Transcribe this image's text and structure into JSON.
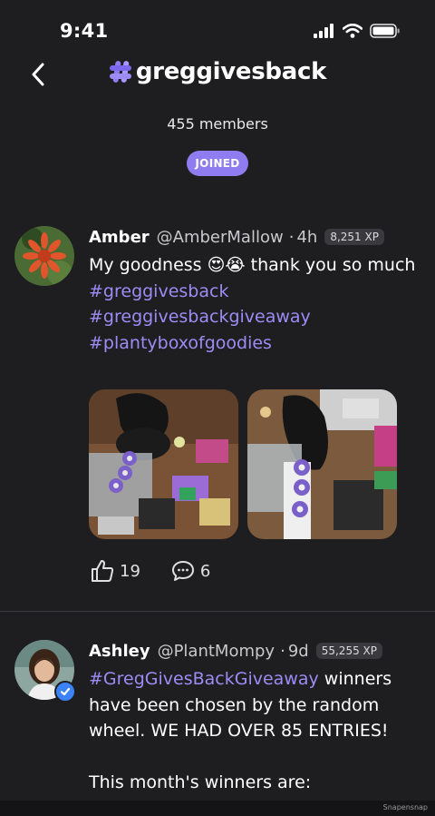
{
  "status_bar": {
    "time": "9:41"
  },
  "header": {
    "title": "greggivesback",
    "members": "455 members",
    "joined_label": "JOINED"
  },
  "posts": [
    {
      "name": "Amber",
      "handle": "@AmberMallow",
      "dot": "·",
      "time": "4h",
      "xp": "8,251 XP",
      "text_line": "My goodness 😍😭 thank you so much",
      "hashtags": [
        "#greggivesback",
        "#greggivesbackgiveaway",
        "#plantyboxofgoodies"
      ],
      "likes": "19",
      "comments": "6"
    },
    {
      "name": "Ashley",
      "handle": "@PlantMompy",
      "dot": "·",
      "time": "9d",
      "xp": "55,255 XP",
      "hashtag_inline": "#GregGivesBackGiveaway",
      "text_rest": " winners have been chosen by the random wheel.  WE HAD OVER 85 ENTRIES!",
      "text_second": "This month's winners are:"
    }
  ],
  "watermark": "Snapensnap",
  "colors": {
    "accent": "#8e7cf0",
    "hashtag": "#9d8cf5",
    "background": "#1e1e20"
  }
}
